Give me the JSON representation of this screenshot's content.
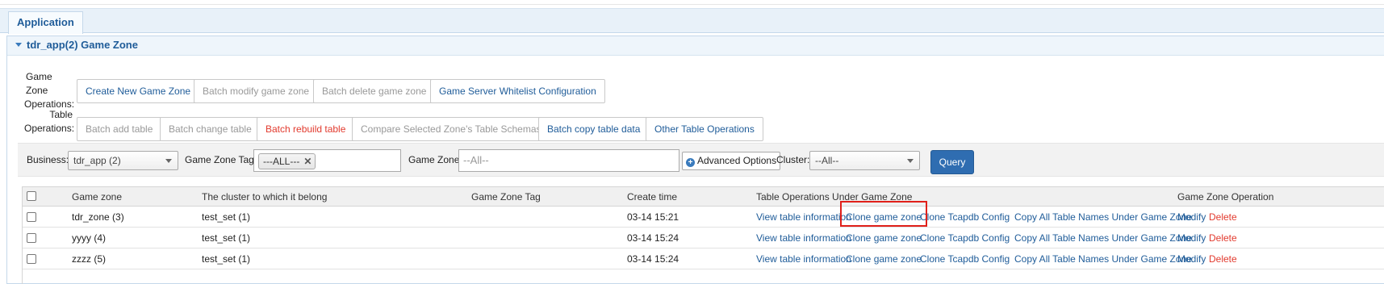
{
  "app_tab": "Application",
  "panel_title": "tdr_app(2) Game Zone",
  "game_zone_ops": {
    "label_line1": "Game Zone",
    "label_line2": "Operations:",
    "buttons": [
      "Create New Game Zone",
      "Batch modify game zone",
      "Batch delete game zone",
      "Game Server Whitelist Configuration"
    ]
  },
  "table_ops": {
    "label_line1": "Table",
    "label_line2": "Operations:",
    "buttons": [
      "Batch add table",
      "Batch change table",
      "Batch rebuild table",
      "Compare Selected Zone's Table Schemas",
      "Batch copy table data",
      "Other Table Operations"
    ]
  },
  "filters": {
    "business_label": "Business:",
    "business_value": "tdr_app (2)",
    "zone_tag_label": "Game Zone Tag:",
    "zone_tag_value": "---ALL---",
    "game_zone_label": "Game Zone:",
    "game_zone_placeholder": "--All--",
    "advanced_label": "Advanced Options",
    "cluster_label": "Cluster:",
    "cluster_value": "--All--",
    "query_label": "Query"
  },
  "table": {
    "columns": [
      "Game zone",
      "The cluster to which it belong",
      "Game Zone Tag",
      "Create time",
      "Table Operations Under Game Zone",
      "Game Zone Operation"
    ],
    "action_labels": {
      "view": "View table information",
      "clone_zone": "Clone game zone",
      "clone_tcapdb": "Clone Tcapdb Config",
      "copy_names": "Copy All Table Names Under Game Zone",
      "modify": "Modify",
      "delete": "Delete"
    },
    "rows": [
      {
        "zone": "tdr_zone (3)",
        "cluster": "test_set (1)",
        "tag": "",
        "time": "03-14 15:21"
      },
      {
        "zone": "yyyy (4)",
        "cluster": "test_set (1)",
        "tag": "",
        "time": "03-14 15:24"
      },
      {
        "zone": "zzzz (5)",
        "cluster": "test_set (1)",
        "tag": "",
        "time": "03-14 15:24"
      }
    ]
  },
  "colors": {
    "link_blue": "#1f5c99",
    "danger_red": "#e23a2e",
    "query_blue": "#2f6db1",
    "highlight_red": "#e0201a"
  }
}
